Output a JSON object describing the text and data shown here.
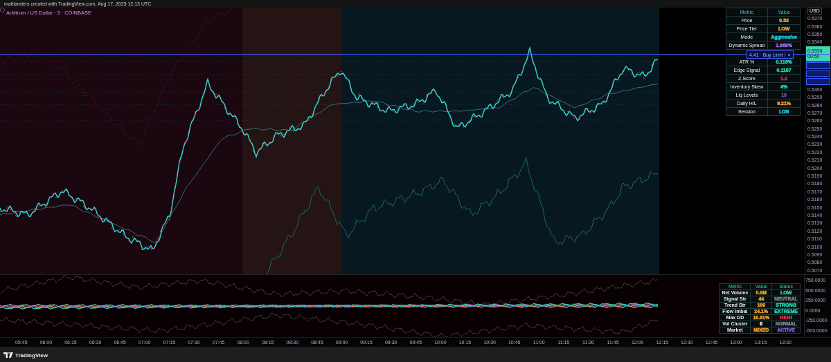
{
  "header": {
    "credit": "mattlanders created with TradingView.com, Aug 17, 2025 12:13 UTC",
    "symbol": "Arbitrum / US Dollar · 3 · COINBASE"
  },
  "order_line": {
    "quantity": "4.41",
    "label": "Buy Limit",
    "close": "×"
  },
  "price_axis": {
    "currency": "USD",
    "items": [
      {
        "kind": "label",
        "text": "0.5370"
      },
      {
        "kind": "label",
        "text": "0.5360"
      },
      {
        "kind": "label",
        "text": "0.5350"
      },
      {
        "kind": "label",
        "text": "0.5340"
      },
      {
        "kind": "tag",
        "text": "0.5336",
        "sub": "00:50"
      },
      {
        "kind": "marker"
      },
      {
        "kind": "marker"
      },
      {
        "kind": "marker"
      },
      {
        "kind": "label",
        "text": "0.5300"
      },
      {
        "kind": "label",
        "text": "0.5290"
      },
      {
        "kind": "label",
        "text": "0.5280"
      },
      {
        "kind": "label",
        "text": "0.5270"
      },
      {
        "kind": "label",
        "text": "0.5260"
      },
      {
        "kind": "label",
        "text": "0.5250"
      },
      {
        "kind": "label",
        "text": "0.5240"
      },
      {
        "kind": "label",
        "text": "0.5230"
      },
      {
        "kind": "label",
        "text": "0.5220"
      },
      {
        "kind": "label",
        "text": "0.5210"
      },
      {
        "kind": "label",
        "text": "0.5200"
      },
      {
        "kind": "label",
        "text": "0.5190"
      },
      {
        "kind": "label",
        "text": "0.5180"
      },
      {
        "kind": "label",
        "text": "0.5170"
      },
      {
        "kind": "label",
        "text": "0.5160"
      },
      {
        "kind": "label",
        "text": "0.5150"
      },
      {
        "kind": "label",
        "text": "0.5140"
      },
      {
        "kind": "label",
        "text": "0.5130"
      },
      {
        "kind": "label",
        "text": "0.5120"
      },
      {
        "kind": "label",
        "text": "0.5110"
      },
      {
        "kind": "label",
        "text": "0.5100"
      },
      {
        "kind": "label",
        "text": "0.5090"
      },
      {
        "kind": "label",
        "text": "0.5080"
      },
      {
        "kind": "label",
        "text": "0.5070"
      }
    ]
  },
  "metrics_table": {
    "columns": [
      "Metric",
      "Value"
    ],
    "rows": [
      {
        "kind": "row",
        "metric": "Price",
        "value": "0.53",
        "color": "#f0a030"
      },
      {
        "kind": "row",
        "metric": "Price Tier",
        "value": "LOW",
        "color": "#f0a030"
      },
      {
        "kind": "row",
        "metric": "Mode",
        "value": "Aggressive",
        "color": "#26c6da"
      },
      {
        "kind": "row",
        "metric": "Dynamic Spread",
        "value": "1.068%",
        "color": "#9c6cf0"
      },
      {
        "kind": "hidden"
      },
      {
        "kind": "row",
        "metric": "ATR %",
        "value": "0.119%",
        "color": "#26d6b0"
      },
      {
        "kind": "row",
        "metric": "Edge Signal",
        "value": "0.1167",
        "color": "#26d6b0"
      },
      {
        "kind": "row",
        "metric": "Z-Score",
        "value": "1.2",
        "color": "#e0304a"
      },
      {
        "kind": "row",
        "metric": "Inventory Skew",
        "value": "4%",
        "color": "#26d6b0"
      },
      {
        "kind": "row",
        "metric": "Liq Levels",
        "value": "10",
        "color": "#6a4ca0"
      },
      {
        "kind": "row",
        "metric": "Daily H/L",
        "value": "9.21%",
        "color": "#f0a030"
      },
      {
        "kind": "row",
        "metric": "Session",
        "value": "LDN",
        "color": "#26c6da"
      }
    ]
  },
  "flow_axis": [
    "750.0000",
    "500.0000",
    "250.0000",
    "0.0000",
    "-250.0000",
    "-500.0000"
  ],
  "flow_table": {
    "columns": [
      "Metric",
      "Value",
      "Status"
    ],
    "rows": [
      {
        "metric": "Net Volume",
        "value": {
          "text": "0.0M",
          "color": "#f0a030"
        },
        "status": {
          "text": "LOW",
          "color": "#26d6b0"
        }
      },
      {
        "metric": "Signal Str",
        "value": {
          "text": "44",
          "color": "#f0a030"
        },
        "status": {
          "text": "NEUTRAL",
          "color": "#808080"
        }
      },
      {
        "metric": "Trend Str",
        "value": {
          "text": "100",
          "color": "#f0a030"
        },
        "status": {
          "text": "STRONG",
          "color": "#26d6b0"
        }
      },
      {
        "metric": "Flow Imbal",
        "value": {
          "text": "24.1%",
          "color": "#f0a030"
        },
        "status": {
          "text": "EXTREME",
          "color": "#26d6b0"
        }
      },
      {
        "metric": "Max DD",
        "value": {
          "text": "10.91%",
          "color": "#f0a030"
        },
        "status": {
          "text": "HIGH",
          "color": "#e0304a"
        }
      },
      {
        "metric": "Vol Cluster",
        "value": {
          "text": "0",
          "color": "#f0f0f0"
        },
        "status": {
          "text": "NORMAL",
          "color": "#808080"
        }
      },
      {
        "metric": "Market",
        "value": {
          "text": "MIXED",
          "color": "#f0a030"
        },
        "status": {
          "text": "ACTIVE",
          "color": "#7c5ce0"
        }
      }
    ]
  },
  "time_axis": [
    "05:45",
    "06:00",
    "06:15",
    "06:30",
    "06:45",
    "07:00",
    "07:15",
    "07:30",
    "07:45",
    "08:00",
    "08:15",
    "08:30",
    "08:45",
    "09:00",
    "09:15",
    "09:30",
    "09:45",
    "10:00",
    "10:15",
    "10:30",
    "10:45",
    "11:00",
    "11:15",
    "11:30",
    "11:45",
    "12:00",
    "12:15",
    "12:30",
    "12:45",
    "13:00",
    "13:15",
    "13:30"
  ],
  "footer": {
    "brand": "TradingView"
  }
}
